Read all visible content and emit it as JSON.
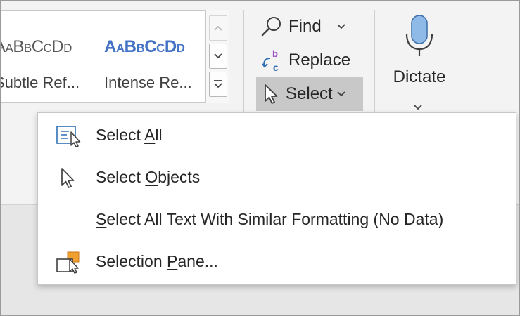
{
  "styles_gallery": {
    "items": [
      {
        "preview": "AaBbCcDd",
        "name": "Subtle Ref..."
      },
      {
        "preview": "AaBbCcDd",
        "name": "Intense Re..."
      }
    ]
  },
  "editing": {
    "find_label": "Find",
    "replace_label": "Replace",
    "select_label": "Select"
  },
  "voice": {
    "dictate_label": "Dictate"
  },
  "select_menu": {
    "items": [
      {
        "pre": "Select ",
        "key": "A",
        "post": "ll",
        "icon": "select-all-icon"
      },
      {
        "pre": "Select ",
        "key": "O",
        "post": "bjects",
        "icon": "select-objects-icon"
      },
      {
        "pre": "",
        "key": "S",
        "post": "elect All Text With Similar Formatting (No Data)",
        "icon": ""
      },
      {
        "pre": "Selection ",
        "key": "P",
        "post": "ane...",
        "icon": "selection-pane-icon"
      }
    ]
  },
  "colors": {
    "accent_blue": "#4472c4",
    "mic_blue": "#8fb9e6",
    "pane_orange": "#f0a030",
    "pressed_button": "#c8c8c8"
  }
}
